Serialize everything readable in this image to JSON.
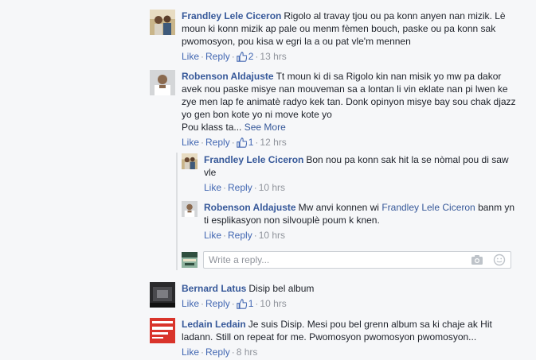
{
  "actions": {
    "like": "Like",
    "reply": "Reply",
    "see_more": "See More"
  },
  "reply_box": {
    "placeholder": "Write a reply..."
  },
  "comments": [
    {
      "author": "Frandley Lele Ciceron",
      "text": "Rigolo al travay tjou ou pa konn anyen nan mizik. Lè moun ki konn mizik ap pale ou menm fèmen bouch, paske ou pa konn sak pwomosyon, pou kisa w egri la a ou pat vle'm mennen",
      "likes": "2",
      "time": "13 hrs"
    },
    {
      "author": "Robenson Aldajuste",
      "text": "Tt moun ki di sa Rigolo kin nan misik yo mw pa dakor avek nou paske misye nan mouveman sa a lontan li vin eklate nan pi lwen ke zye men lap fe animatè radyo kek tan. Donk opinyon misye bay sou chak djazz yo gen bon kote yo ni move kote yo",
      "text_line2": "Pou klass ta...",
      "likes": "1",
      "time": "12 hrs"
    },
    {
      "author": "Bernard Latus",
      "text": "Disip bel album",
      "likes": "1",
      "time": "10 hrs"
    },
    {
      "author": "Ledain Ledain",
      "text": "Je suis Disip. Mesi pou bel grenn album sa ki chaje ak Hit ladann. Still on repeat for me. Pwomosyon pwomosyon pwomosyon...",
      "time": "8 hrs"
    }
  ],
  "replies": [
    {
      "author": "Frandley Lele Ciceron",
      "text": "Bon nou pa konn sak hit la se nòmal pou di saw vle",
      "time": "10 hrs"
    },
    {
      "author": "Robenson Aldajuste",
      "text_before": "Mw anvi konnen wi",
      "mention": "Frandley Lele Ciceron",
      "text_after": "banm yn ti esplikasyon non silvouplè poum k knen.",
      "time": "10 hrs"
    }
  ],
  "colors": {
    "link": "#365899",
    "action": "#4267b2",
    "meta": "#90949c",
    "background": "#f6f7f9"
  },
  "icons": {
    "like": "thumbs-up-icon",
    "camera": "camera-icon",
    "emoji": "smiley-icon"
  }
}
